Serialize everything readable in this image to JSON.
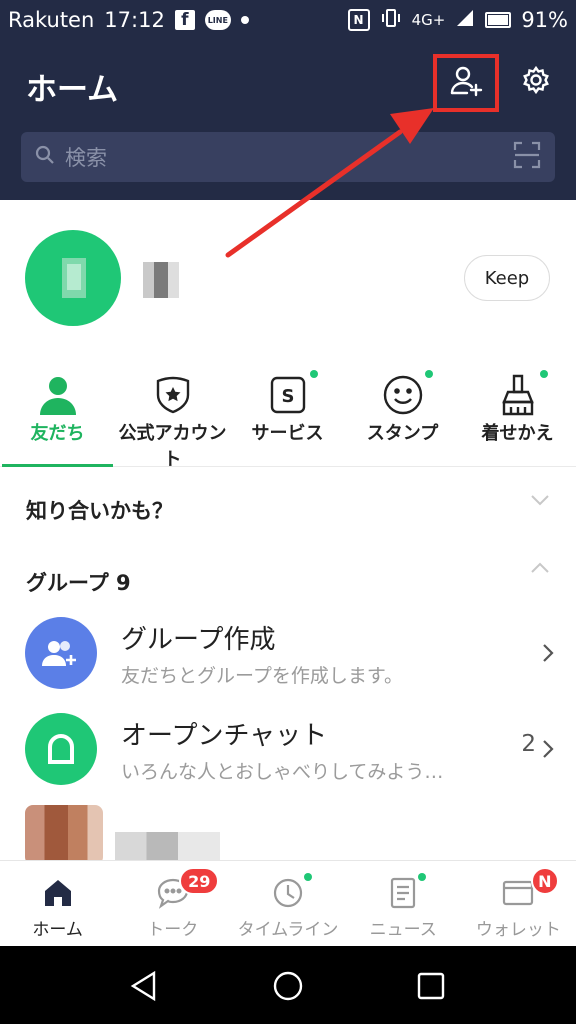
{
  "status_bar": {
    "carrier": "Rakuten",
    "time": "17:12",
    "facebook_label": "f",
    "line_label": "LINE",
    "network": "4G+",
    "battery": "91%"
  },
  "header": {
    "title": "ホーム",
    "search_placeholder": "検索"
  },
  "profile": {
    "keep_label": "Keep"
  },
  "tabs": [
    {
      "label": "友だち",
      "icon": "person-icon",
      "active": true
    },
    {
      "label": "公式アカウント",
      "icon": "shield-star-icon"
    },
    {
      "label": "サービス",
      "icon": "service-s-icon",
      "dot": true
    },
    {
      "label": "スタンプ",
      "icon": "smiley-icon",
      "dot": true
    },
    {
      "label": "着せかえ",
      "icon": "brush-icon",
      "dot": true
    }
  ],
  "service_icon_letter": "S",
  "sections": {
    "suggest_title": "知り合いかも？",
    "groups_title": "グループ 9"
  },
  "rows": [
    {
      "title": "グループ作成",
      "subtitle": "友だちとグループを作成します。",
      "icon": "add-group-icon",
      "color": "#5b7fe7"
    },
    {
      "title": "オープンチャット",
      "subtitle": "いろんな人とおしゃべりしてみよう…",
      "icon": "open-chat-icon",
      "color": "#1fc776",
      "count": "2"
    }
  ],
  "bottom_nav": [
    {
      "label": "ホーム",
      "icon": "home-icon",
      "active": true
    },
    {
      "label": "トーク",
      "icon": "chat-icon",
      "badge": "29"
    },
    {
      "label": "タイムライン",
      "icon": "clock-icon",
      "dot": true
    },
    {
      "label": "ニュース",
      "icon": "news-icon",
      "dot": true
    },
    {
      "label": "ウォレット",
      "icon": "wallet-icon",
      "badge": "N"
    }
  ],
  "colors": {
    "header_bg": "#232b45",
    "accent_green": "#1fb45f",
    "annotation_red": "#e8302a",
    "badge_red": "#ef3d3d"
  }
}
